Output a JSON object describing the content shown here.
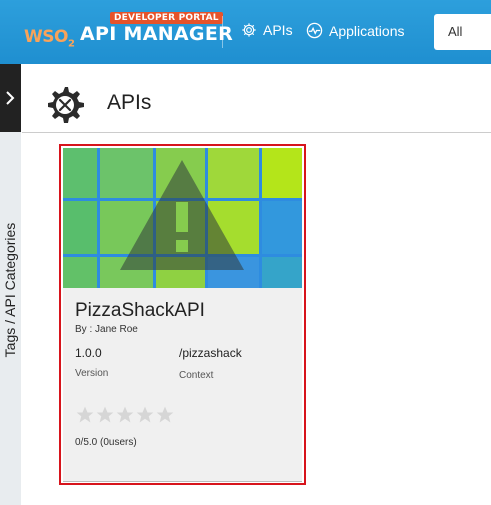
{
  "header": {
    "brand_prefix": "WSO",
    "brand_sub": "2",
    "brand_title": "API MANAGER",
    "badge": "DEVELOPER PORTAL",
    "nav": [
      {
        "label": "APIs",
        "icon": "gear-icon"
      },
      {
        "label": "Applications",
        "icon": "pulse-icon"
      }
    ],
    "search_scope": "All"
  },
  "sidebar": {
    "toggle_icon": "chevron-right-icon",
    "label": "Tags / API Categories"
  },
  "page": {
    "title": "APIs",
    "icon": "gear-tools-icon"
  },
  "apis": [
    {
      "name": "PizzaShackAPI",
      "author": "By : Jane Roe",
      "version": "1.0.0",
      "version_label": "Version",
      "context": "/pizzashack",
      "context_label": "Context",
      "rating": 0,
      "rating_max": 5,
      "rating_text": "0/5.0 (0users)",
      "thumbnail_icon": "warning-icon"
    }
  ],
  "colors": {
    "header": "#2496d8",
    "badge": "#e6532a",
    "selection": "#d7141c",
    "sidebar": "#e8ecef"
  }
}
